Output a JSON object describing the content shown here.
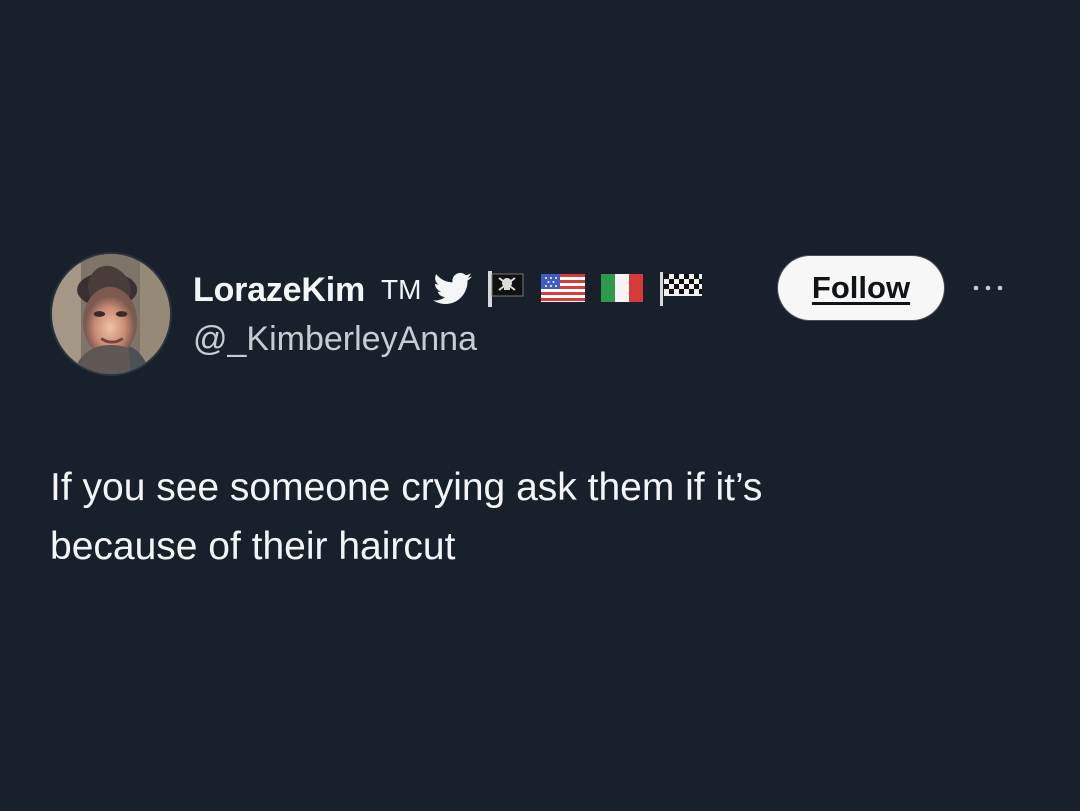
{
  "colors": {
    "background": "#17202a",
    "card": "#18212b",
    "text_primary": "#f3f5f7",
    "text_secondary": "#c7ccd1",
    "follow_bg": "#f7f7f7",
    "follow_text": "#111417"
  },
  "tweet": {
    "author": {
      "display_name": "LorazeKim",
      "name_suffix": "TM",
      "handle": "@_KimberleyAnna",
      "avatar_icon": "profile-photo-avatar",
      "badges": [
        "twitter-bird-icon",
        "pirate-flag-icon",
        "us-flag-icon",
        "italy-flag-icon",
        "checkered-flag-icon"
      ]
    },
    "follow_label": "Follow",
    "more_icon": "more-options-icon",
    "text_lines": [
      "If you see someone crying ask them if it’s",
      "because of their haircut"
    ]
  }
}
